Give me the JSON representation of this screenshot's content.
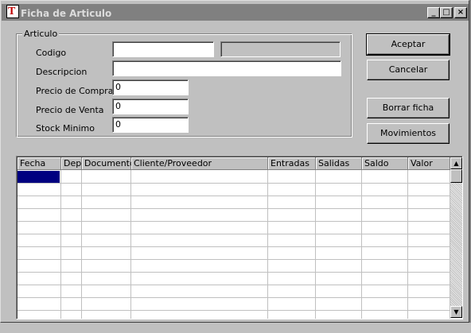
{
  "window": {
    "title": "Ficha de Articulo"
  },
  "title_buttons": {
    "minimize": "_",
    "maximize": "□",
    "close": "×"
  },
  "articulo": {
    "legend": "Articulo",
    "codigo_label": "Codigo",
    "codigo_value": "",
    "codigo_extra_value": "",
    "descripcion_label": "Descripcion",
    "descripcion_value": "",
    "precio_compra_label": "Precio de Compra",
    "precio_compra_value": "0",
    "precio_venta_label": "Precio de Venta",
    "precio_venta_value": "0",
    "stock_minimo_label": "Stock Minimo",
    "stock_minimo_value": "0"
  },
  "buttons": {
    "aceptar": "Aceptar",
    "cancelar": "Cancelar",
    "borrar_ficha": "Borrar ficha",
    "movimientos": "Movimientos"
  },
  "grid": {
    "columns": [
      "Fecha",
      "Dep",
      "Documento",
      "Cliente/Proveedor",
      "Entradas",
      "Salidas",
      "Saldo",
      "Valor"
    ],
    "scroll_up": "▲",
    "scroll_down": "▼"
  },
  "colors": {
    "face": "#c0c0c0",
    "titlebar_inactive": "#808080",
    "selection": "#000080"
  }
}
